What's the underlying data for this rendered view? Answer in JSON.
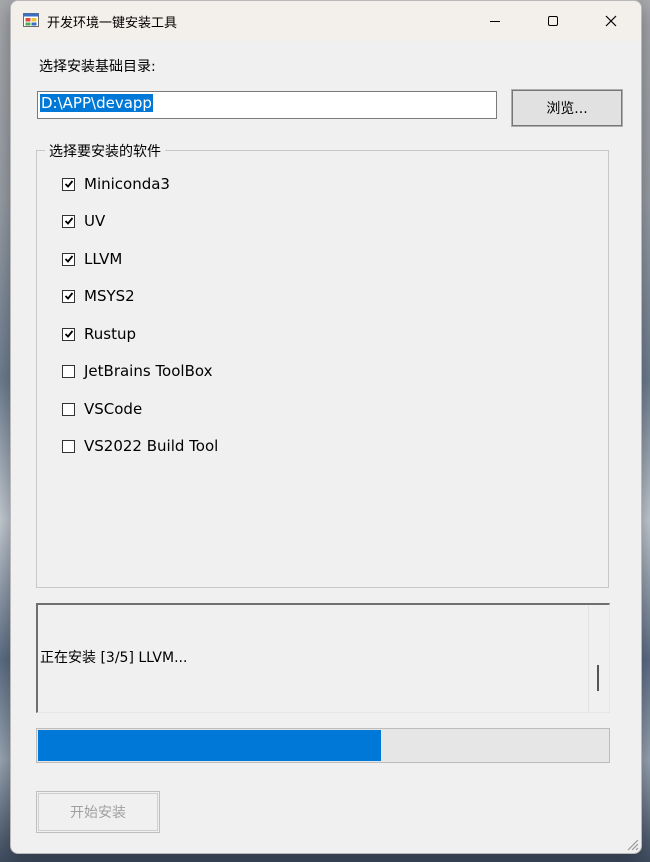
{
  "window": {
    "title": "开发环境一键安装工具",
    "controls": {
      "minimize_icon": "minimize-icon",
      "maximize_icon": "maximize-icon",
      "close_icon": "close-icon"
    }
  },
  "install_dir": {
    "label": "选择安装基础目录:",
    "value": "D:\\APP\\devapp",
    "browse_label": "浏览..."
  },
  "software": {
    "group_title": "选择要安装的软件",
    "items": [
      {
        "label": "Miniconda3",
        "checked": true
      },
      {
        "label": "UV",
        "checked": true
      },
      {
        "label": "LLVM",
        "checked": true
      },
      {
        "label": "MSYS2",
        "checked": true
      },
      {
        "label": "Rustup",
        "checked": true
      },
      {
        "label": "JetBrains ToolBox",
        "checked": false
      },
      {
        "label": "VSCode",
        "checked": false
      },
      {
        "label": "VS2022 Build Tool",
        "checked": false
      }
    ]
  },
  "log": {
    "text": "正在安装 [3/5] LLVM..."
  },
  "progress": {
    "fraction": 0.6,
    "color": "#0078d7"
  },
  "actions": {
    "start_label": "开始安装",
    "start_enabled": false
  }
}
